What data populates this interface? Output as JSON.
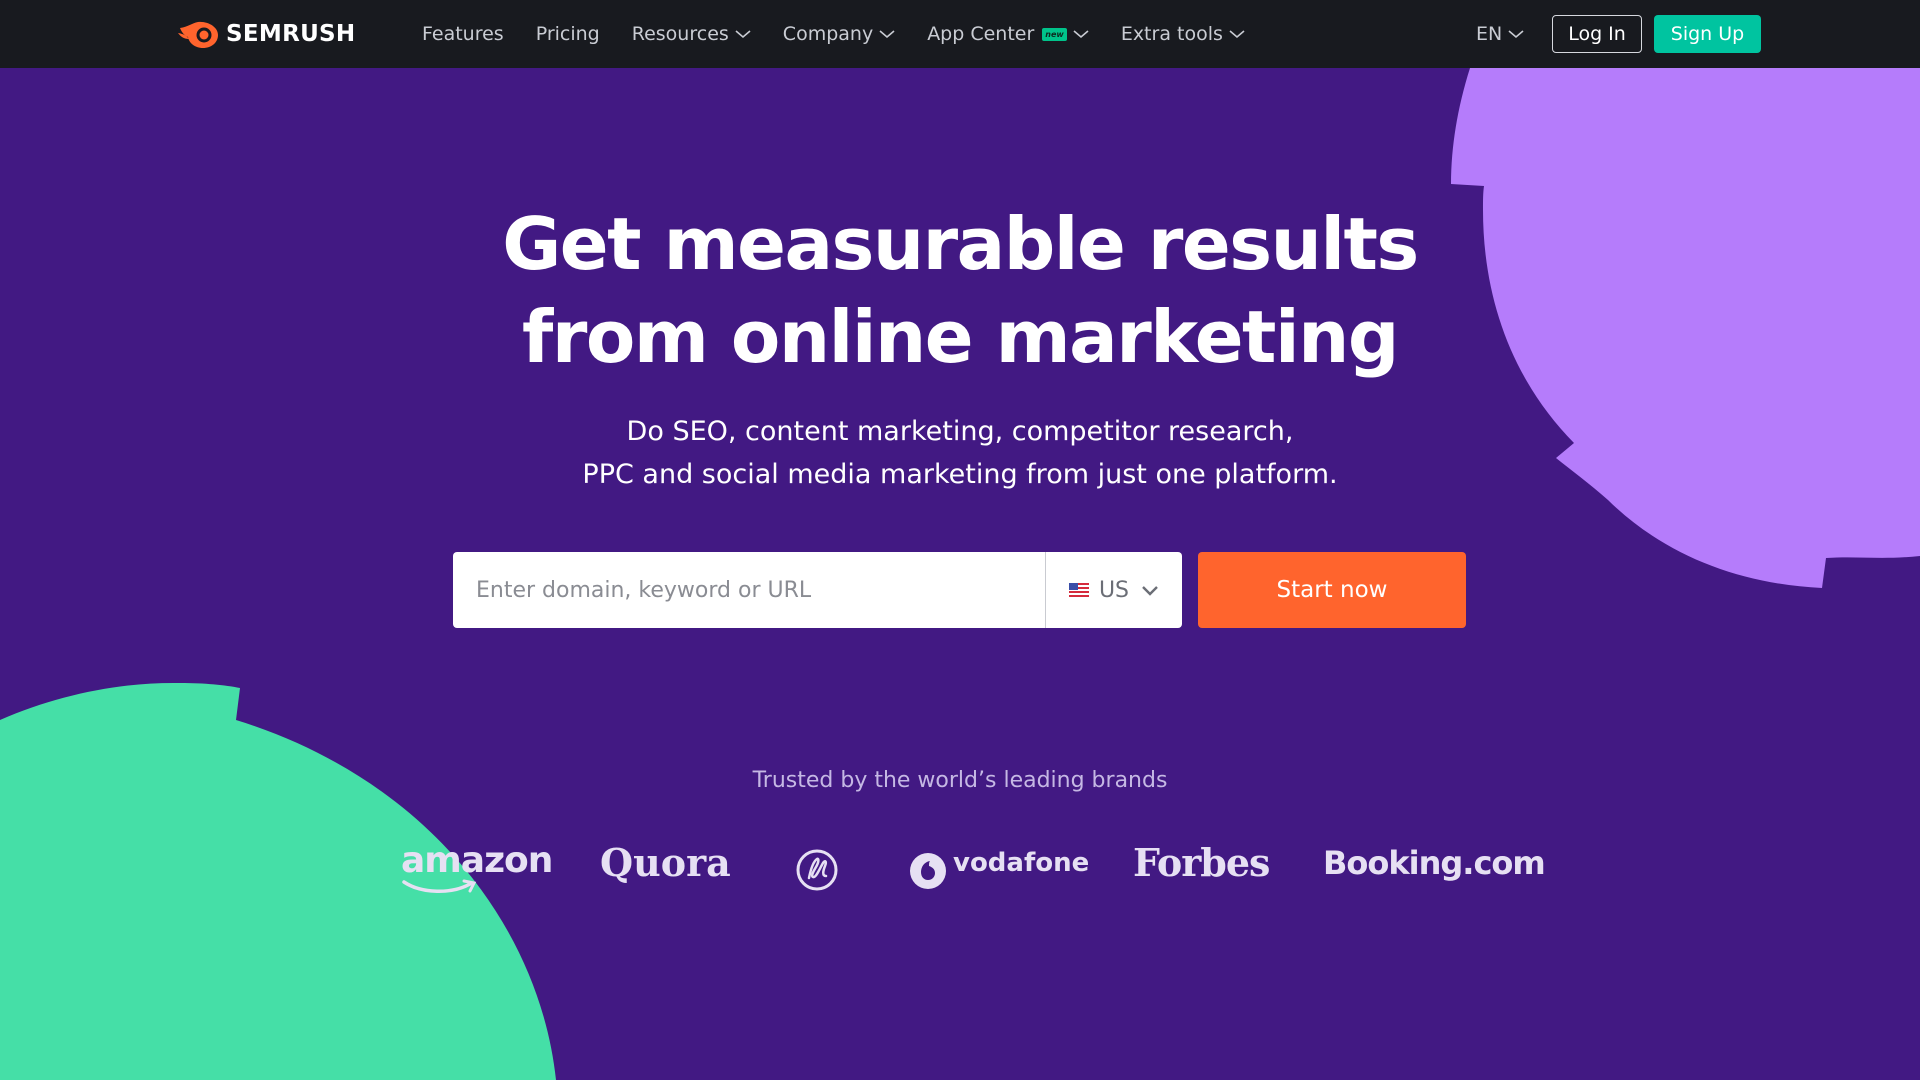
{
  "header": {
    "logo_text": "SEMRUSH",
    "nav": [
      {
        "label": "Features",
        "has_dropdown": false
      },
      {
        "label": "Pricing",
        "has_dropdown": false
      },
      {
        "label": "Resources",
        "has_dropdown": true
      },
      {
        "label": "Company",
        "has_dropdown": true
      },
      {
        "label": "App Center",
        "has_dropdown": true,
        "badge": "new"
      },
      {
        "label": "Extra tools",
        "has_dropdown": true
      }
    ],
    "language": "EN",
    "login_label": "Log In",
    "signup_label": "Sign Up"
  },
  "hero": {
    "title_line1": "Get measurable results",
    "title_line2": "from online marketing",
    "subtitle_line1": "Do SEO, content marketing, competitor research,",
    "subtitle_line2": "PPC and social media marketing from just one platform."
  },
  "search": {
    "placeholder": "Enter domain, keyword or URL",
    "value": "",
    "database": "US",
    "database_icon": "us-flag-icon",
    "submit_label": "Start now"
  },
  "trusted": {
    "caption": "Trusted by the world’s leading brands",
    "brands": [
      "amazon",
      "Quora",
      "GE",
      "vodafone",
      "Forbes",
      "Booking.com"
    ]
  },
  "colors": {
    "background": "#421983",
    "header": "#181a1f",
    "accent_orange": "#ff642d",
    "accent_teal": "#00c4a0",
    "shape_purple": "#b57cfb",
    "shape_green": "#45dfa7"
  }
}
